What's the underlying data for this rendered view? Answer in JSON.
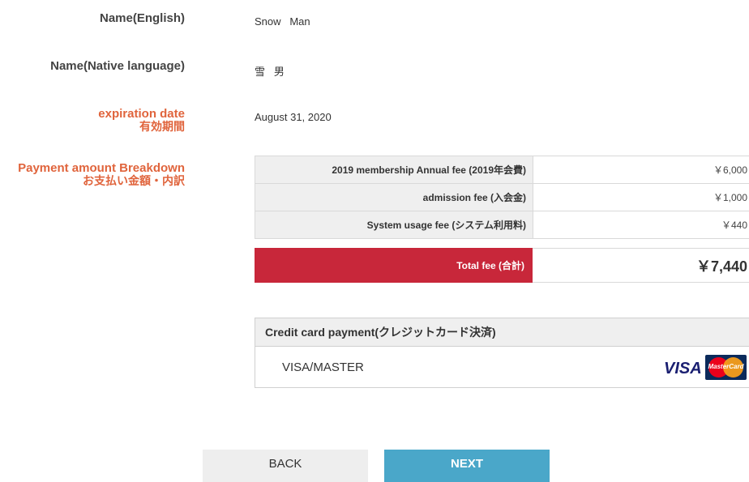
{
  "fields": {
    "name_english": {
      "label": "Name(English)",
      "value": "Snow   Man"
    },
    "name_native": {
      "label": "Name(Native language)",
      "value": "雪   男"
    },
    "expiration": {
      "label": "expiration date",
      "label_ja": "有効期間",
      "value": "August 31, 2020"
    },
    "payment": {
      "label": "Payment amount Breakdown",
      "label_ja": "お支払い金額・内訳"
    }
  },
  "fees": [
    {
      "label": "2019 membership Annual fee (2019年会費)",
      "amount": "￥6,000"
    },
    {
      "label": "admission fee (入会金)",
      "amount": "￥1,000"
    },
    {
      "label": "System usage fee (システム利用料)",
      "amount": "￥440"
    }
  ],
  "total": {
    "label": "Total fee (合計)",
    "amount": "￥7,440"
  },
  "credit_card": {
    "header": "Credit card payment(クレジットカード決済)",
    "option": "VISA/MASTER",
    "visa_text": "VISA",
    "mastercard_text": "MasterCard"
  },
  "buttons": {
    "back": "BACK",
    "next": "NEXT"
  },
  "colors": {
    "accent_label": "#e0643c",
    "total_bg": "#c8273a",
    "next_bg": "#4aa7c9"
  }
}
